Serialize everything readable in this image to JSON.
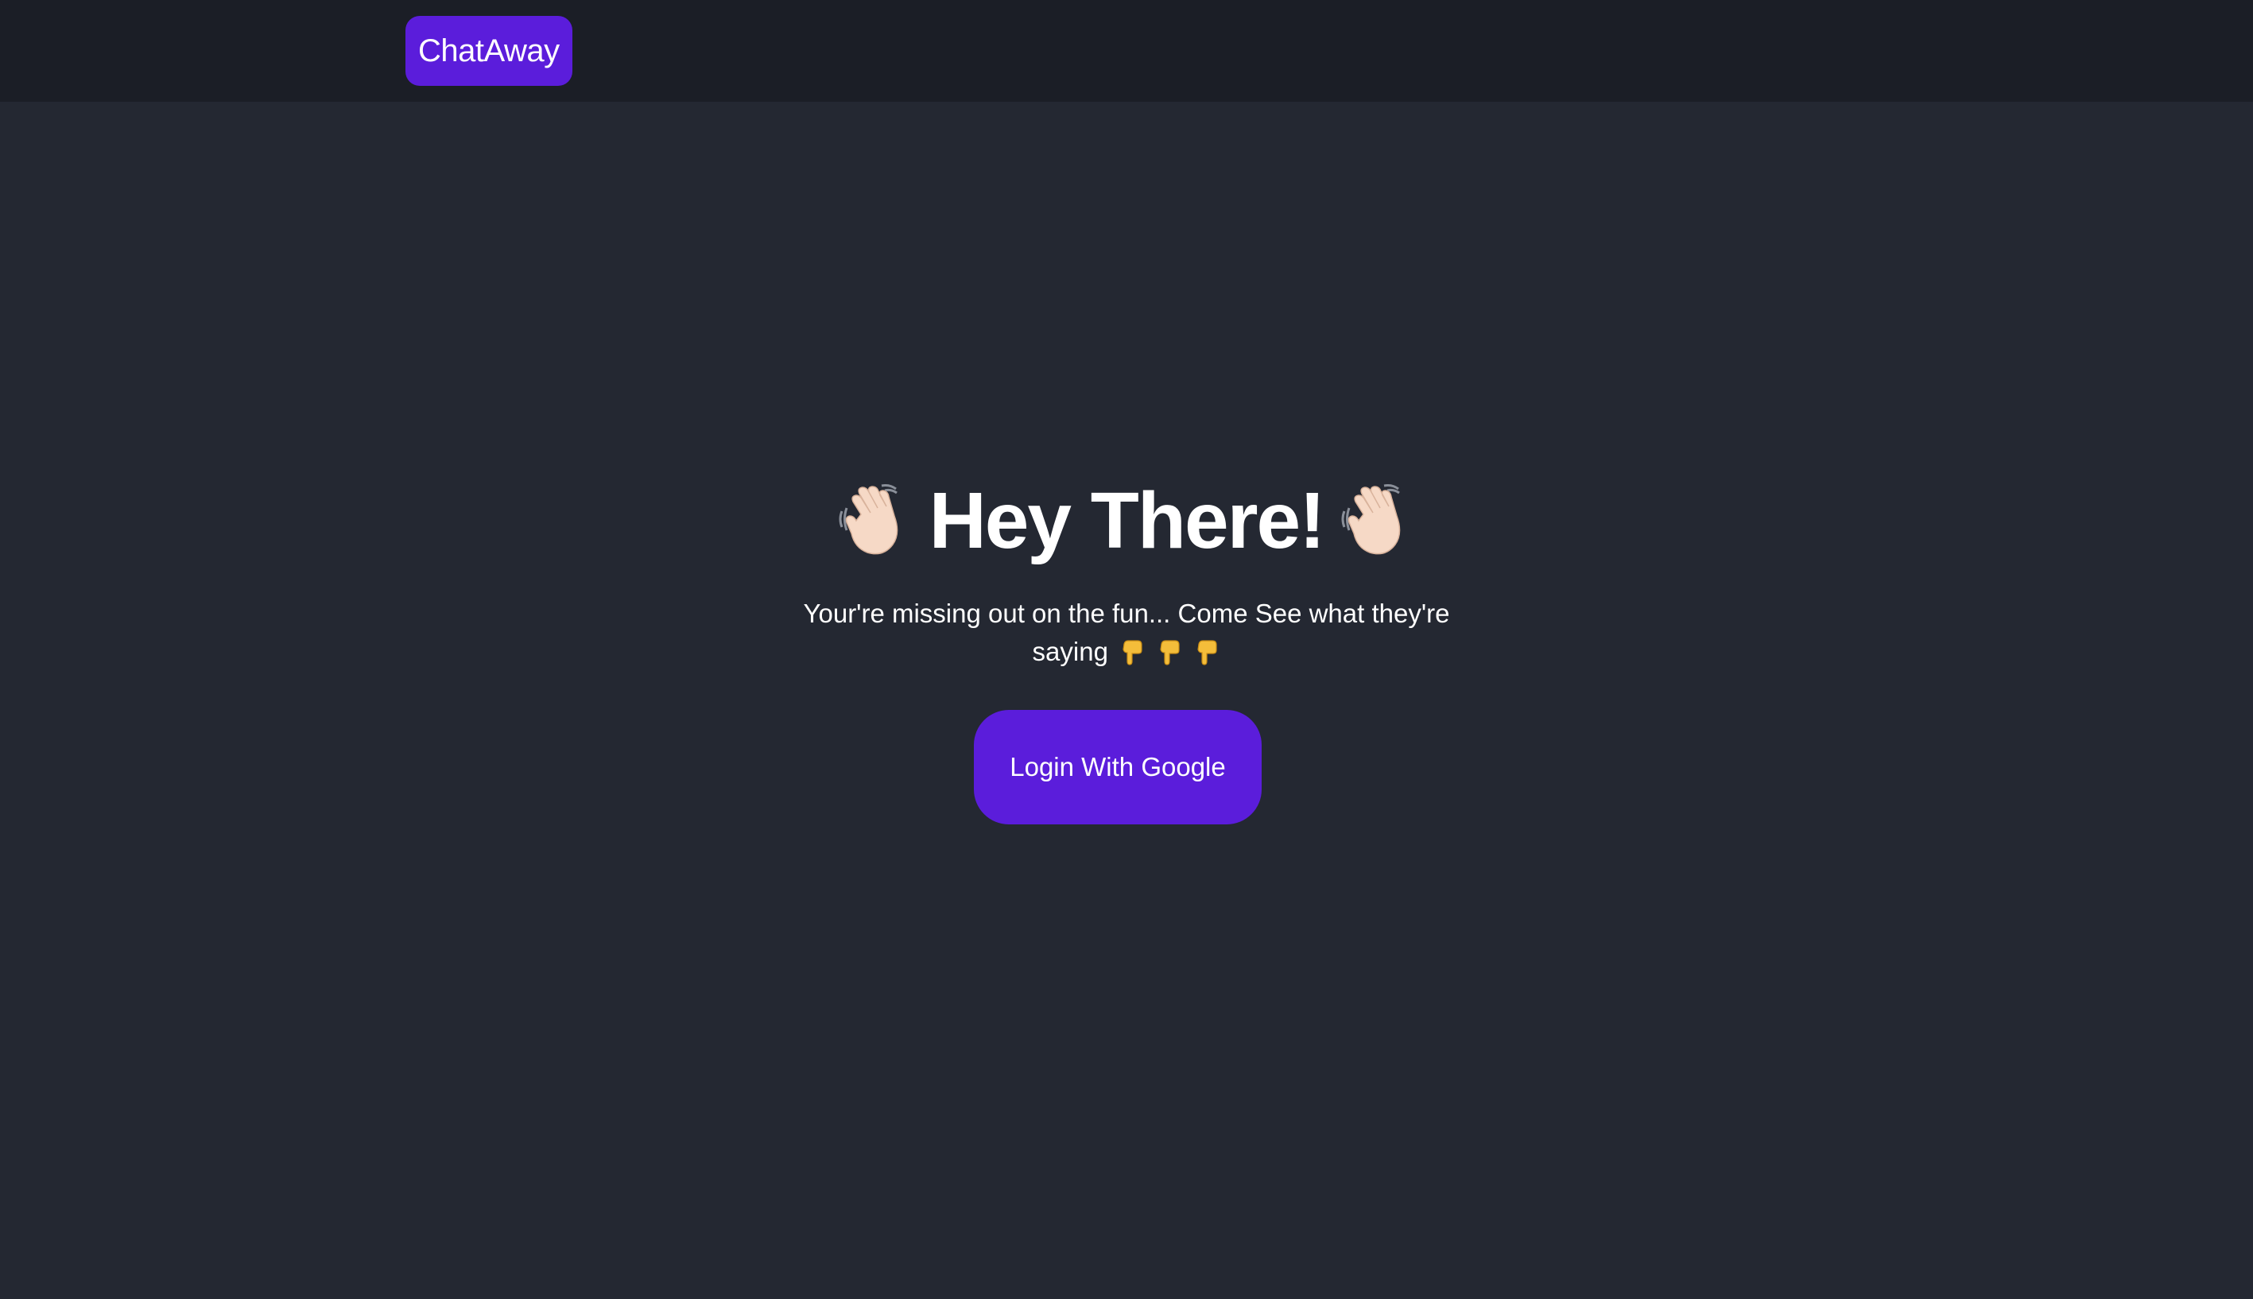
{
  "nav": {
    "brand": "ChatAway"
  },
  "hero": {
    "title": "Hey There!",
    "subtitle_line1": "Your're missing out on the fun... Come See what they're",
    "subtitle_line2": "saying",
    "login_button": "Login With Google"
  },
  "icons": {
    "left_title_icon": "waving-hand-icon",
    "right_title_icon": "waving-hand-icon",
    "subtitle_icons": [
      "pointing-down-icon",
      "pointing-down-icon",
      "pointing-down-icon"
    ]
  },
  "colors": {
    "page_background": "#242832",
    "nav_background": "#1b1e26",
    "accent": "#5b1ddb",
    "text": "#ffffff"
  }
}
